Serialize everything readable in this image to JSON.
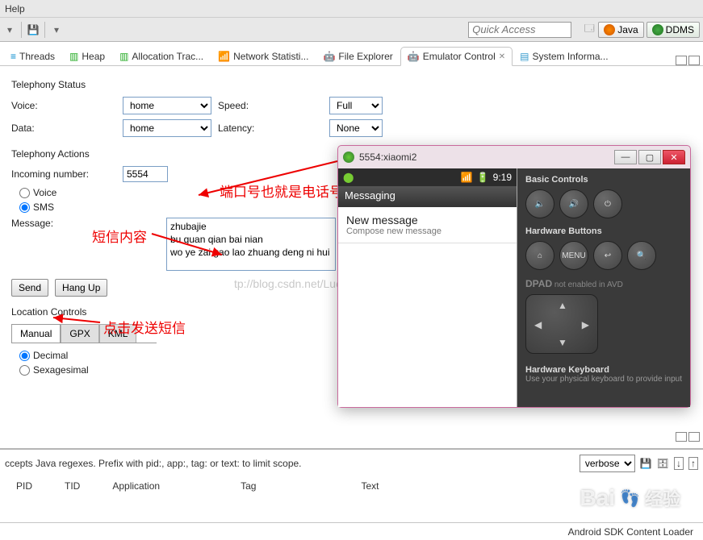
{
  "menu": {
    "help": "Help"
  },
  "quick_access_placeholder": "Quick Access",
  "perspectives": {
    "java": "Java",
    "ddms": "DDMS"
  },
  "tabs": {
    "threads": "Threads",
    "heap": "Heap",
    "alloc": "Allocation Trac...",
    "netstat": "Network Statisti...",
    "fileexp": "File Explorer",
    "emuctrl": "Emulator Control",
    "sysinfo": "System Informa..."
  },
  "telephony": {
    "status_title": "Telephony Status",
    "voice_label": "Voice:",
    "voice_value": "home",
    "speed_label": "Speed:",
    "speed_value": "Full",
    "data_label": "Data:",
    "data_value": "home",
    "latency_label": "Latency:",
    "latency_value": "None",
    "actions_title": "Telephony Actions",
    "incoming_label": "Incoming number:",
    "incoming_value": "5554",
    "voice_radio": "Voice",
    "sms_radio": "SMS",
    "message_label": "Message:",
    "message_value": "zhubajie\nbu guan qian bai nian\nwo ye zai gao lao zhuang deng ni hui",
    "send": "Send",
    "hangup": "Hang Up"
  },
  "location": {
    "title": "Location Controls",
    "tabs": {
      "manual": "Manual",
      "gpx": "GPX",
      "kml": "KML"
    },
    "decimal": "Decimal",
    "sexagesimal": "Sexagesimal"
  },
  "emulator": {
    "window_title": "5554:xiaomi2",
    "time": "9:19",
    "screen_title": "Messaging",
    "new_msg": "New message",
    "compose": "Compose new message",
    "basic_controls": "Basic Controls",
    "hardware_buttons": "Hardware Buttons",
    "menu": "MENU",
    "dpad_note": "DPAD not enabled in AVD",
    "hk_title": "Hardware Keyboard",
    "hk_sub": "Use your physical keyboard to provide input"
  },
  "annotations": {
    "a1": "端口号也就是电话号码",
    "a2": "短信内容",
    "a3": "点击发送短信"
  },
  "bottom": {
    "regex_hint": "ccepts Java regexes. Prefix with pid:, app:, tag: or text: to limit scope.",
    "verbose": "verbose",
    "cols": {
      "pid": "PID",
      "tid": "TID",
      "app": "Application",
      "tag": "Tag",
      "text": "Text"
    }
  },
  "status": {
    "loader": "Android SDK Content Loader"
  },
  "blog_watermark": "tp://blog.csdn.net/LuckChouDog",
  "baidu_wm": "Baidು 经验"
}
